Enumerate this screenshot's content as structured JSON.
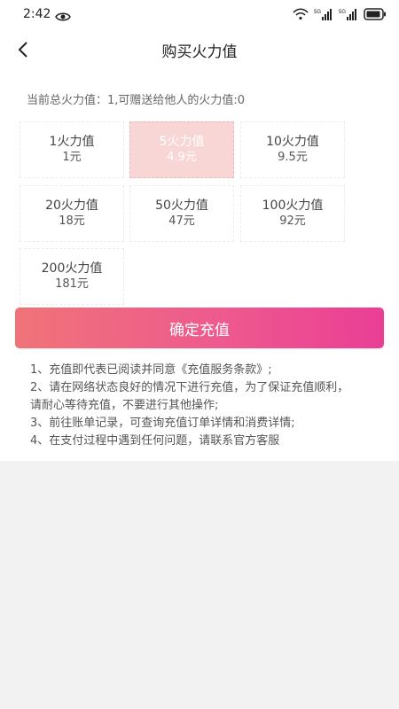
{
  "status_bar": {
    "time": "2:42",
    "battery_icon": "battery-icon",
    "wifi_icon": "wifi-icon"
  },
  "header": {
    "title": "购买火力值",
    "back_icon": "chevron-left-icon"
  },
  "balance_text": "当前总火力值：1,可赠送给他人的火力值:0",
  "options": [
    {
      "amount": "1火力值",
      "price": "1元",
      "selected": false
    },
    {
      "amount": "5火力值",
      "price": "4.9元",
      "selected": true
    },
    {
      "amount": "10火力值",
      "price": "9.5元",
      "selected": false
    },
    {
      "amount": "20火力值",
      "price": "18元",
      "selected": false
    },
    {
      "amount": "50火力值",
      "price": "47元",
      "selected": false
    },
    {
      "amount": "100火力值",
      "price": "92元",
      "selected": false
    },
    {
      "amount": "200火力值",
      "price": "181元",
      "selected": false
    }
  ],
  "confirm_label": "确定充值",
  "notes": [
    "1、充值即代表已阅读并同意《充值服务条款》;",
    "2、请在网络状态良好的情况下进行充值，为了保证充值顺利，请耐心等待充值，不要进行其他操作;",
    "3、前往账单记录，可查询充值订单详情和消费详情;",
    "4、在支付过程中遇到任何问题，请联系官方客服"
  ],
  "colors": {
    "selected_bg": "#f9d6d6",
    "button_start": "#f07378",
    "button_end": "#ea3e95"
  }
}
